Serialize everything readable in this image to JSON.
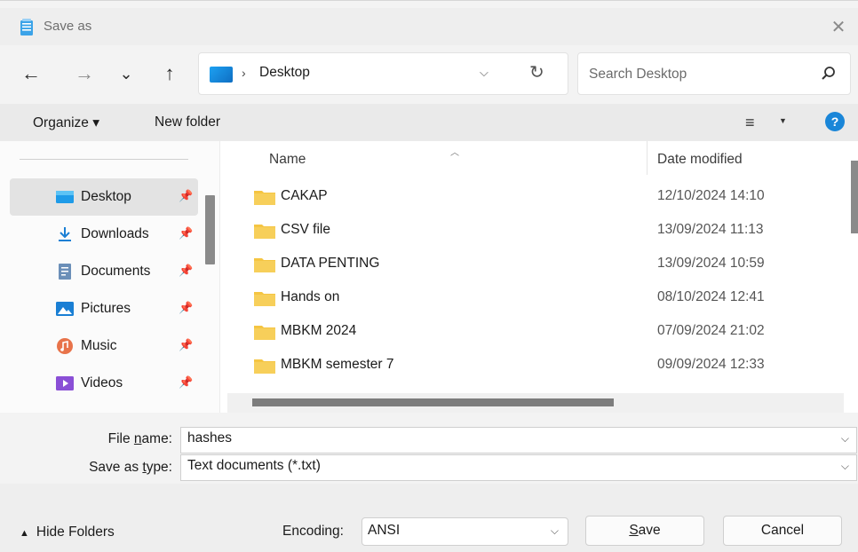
{
  "window": {
    "title": "Save as",
    "close_label": "✕"
  },
  "nav": {
    "back": "←",
    "forward": "→",
    "recent": "⌄",
    "up": "↑",
    "breadcrumb_sep": "›",
    "location": "Desktop",
    "search_placeholder": "Search Desktop"
  },
  "command_bar": {
    "organize": "Organize ▾",
    "new_folder": "New folder",
    "view": "≡",
    "help": "?"
  },
  "sidebar": {
    "items": [
      {
        "label": "Desktop",
        "icon": "desktop-icon"
      },
      {
        "label": "Downloads",
        "icon": "downloads-icon"
      },
      {
        "label": "Documents",
        "icon": "documents-icon"
      },
      {
        "label": "Pictures",
        "icon": "pictures-icon"
      },
      {
        "label": "Music",
        "icon": "music-icon"
      },
      {
        "label": "Videos",
        "icon": "videos-icon"
      }
    ],
    "pin": "📌"
  },
  "file_list": {
    "columns": {
      "name": "Name",
      "date": "Date modified"
    },
    "rows": [
      {
        "name": "CAKAP",
        "date": "12/10/2024 14:10"
      },
      {
        "name": "CSV file",
        "date": "13/09/2024 11:13"
      },
      {
        "name": "DATA PENTING",
        "date": "13/09/2024 10:59"
      },
      {
        "name": "Hands on",
        "date": "08/10/2024 12:41"
      },
      {
        "name": "MBKM 2024",
        "date": "07/09/2024 21:02"
      },
      {
        "name": "MBKM semester 7",
        "date": "09/09/2024 12:33"
      }
    ]
  },
  "form": {
    "file_name_label_pre": "File ",
    "file_name_label_u": "n",
    "file_name_label_post": "ame:",
    "file_name_value": "hashes",
    "type_label_pre": "Save as ",
    "type_label_u": "t",
    "type_label_post": "ype:",
    "type_value": "Text documents (*.txt)"
  },
  "footer": {
    "hide_folders": "Hide Folders",
    "encoding_label": "Encoding:",
    "encoding_value": "ANSI",
    "save_u": "S",
    "save_rest": "ave",
    "cancel": "Cancel"
  },
  "colors": {
    "accent": "#1a86d8",
    "folder": "#f5c542",
    "selected": "#e3e3e3"
  }
}
